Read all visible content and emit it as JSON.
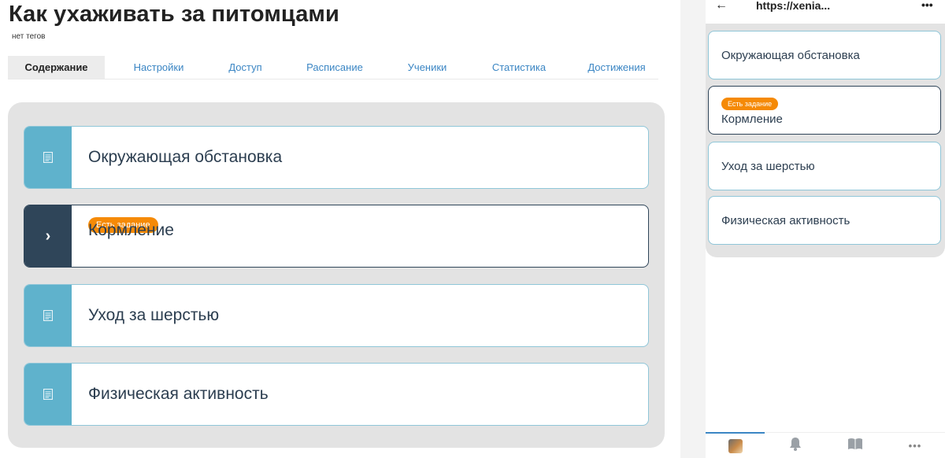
{
  "desktop": {
    "title": "Как ухаживать за питомцами",
    "tags_text": "нет тегов",
    "tabs": [
      {
        "label": "Содержание"
      },
      {
        "label": "Настройки"
      },
      {
        "label": "Доступ"
      },
      {
        "label": "Расписание"
      },
      {
        "label": "Ученики"
      },
      {
        "label": "Статистика"
      },
      {
        "label": "Достижения"
      }
    ],
    "active_tab": "Содержание",
    "lessons": [
      {
        "title": "Окружающая обстановка",
        "icon": "document-icon",
        "state": "default"
      },
      {
        "title": "Кормление",
        "icon": "chevron-right-icon",
        "state": "current",
        "badge": "Есть задание"
      },
      {
        "title": "Уход за шерстью",
        "icon": "document-icon",
        "state": "default"
      },
      {
        "title": "Физическая активность",
        "icon": "document-icon",
        "state": "default"
      }
    ]
  },
  "mobile": {
    "back_icon": "arrow-left-icon",
    "url": "https://xenia...",
    "menu_icon": "more-icon",
    "lessons": [
      {
        "title": "Окружающая обстановка"
      },
      {
        "title": "Кормление",
        "badge": "Есть задание"
      },
      {
        "title": "Уход за шерстью"
      },
      {
        "title": "Физическая активность"
      }
    ],
    "nav": [
      {
        "icon": "avatar-icon"
      },
      {
        "icon": "bell-icon"
      },
      {
        "icon": "book-icon"
      },
      {
        "icon": "more-icon"
      }
    ]
  },
  "colors": {
    "accent": "#5fb2cc",
    "current": "#2f4559",
    "badge": "#f58a07",
    "link": "#3b86c4"
  }
}
